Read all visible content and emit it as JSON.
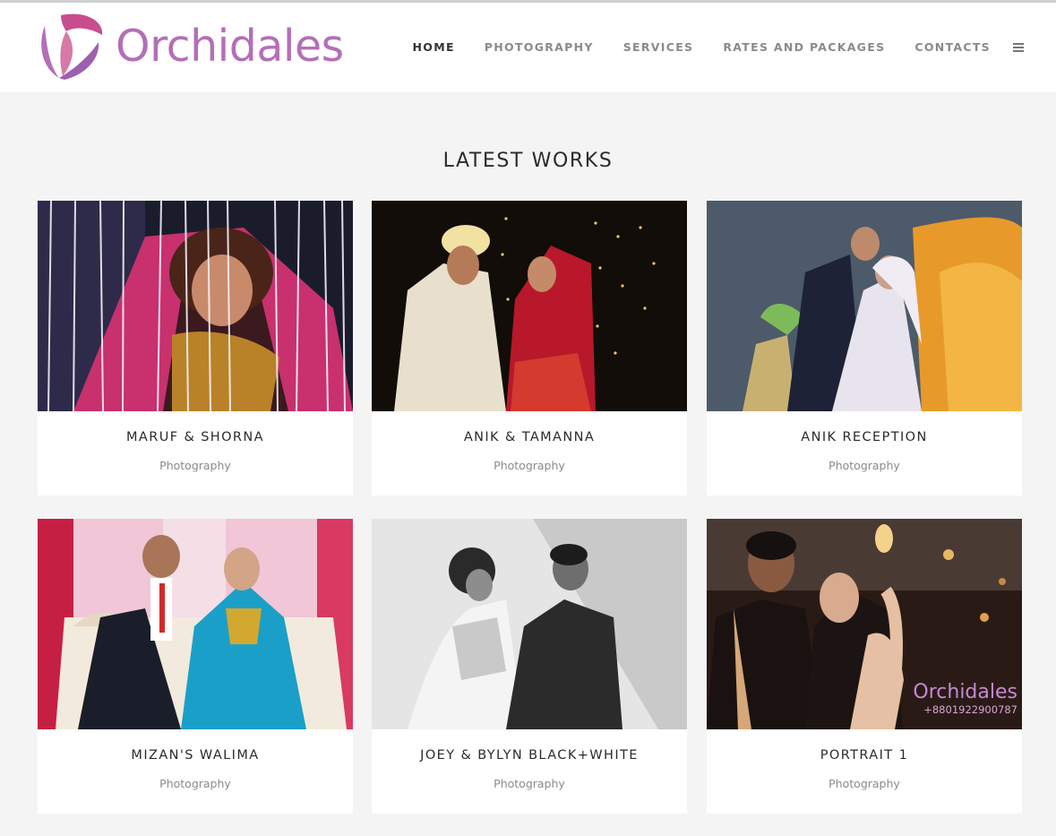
{
  "brand": {
    "name": "Orchidales",
    "color": "#b36fb8"
  },
  "nav": [
    {
      "label": "HOME",
      "active": true
    },
    {
      "label": "PHOTOGRAPHY",
      "active": false
    },
    {
      "label": "SERVICES",
      "active": false
    },
    {
      "label": "RATES AND PACKAGES",
      "active": false
    },
    {
      "label": "CONTACTS",
      "active": false
    }
  ],
  "section": {
    "title": "LATEST WORKS"
  },
  "works": [
    {
      "title": "MARUF & SHORNA",
      "category": "Photography"
    },
    {
      "title": "ANIK & TAMANNA",
      "category": "Photography"
    },
    {
      "title": "ANIK RECEPTION",
      "category": "Photography"
    },
    {
      "title": "MIZAN'S WALIMA",
      "category": "Photography"
    },
    {
      "title": "JOEY & BYLYN BLACK+WHITE",
      "category": "Photography"
    },
    {
      "title": "PORTRAIT 1",
      "category": "Photography"
    }
  ],
  "watermark": {
    "name": "Orchidales",
    "phone": "+8801922900787"
  }
}
